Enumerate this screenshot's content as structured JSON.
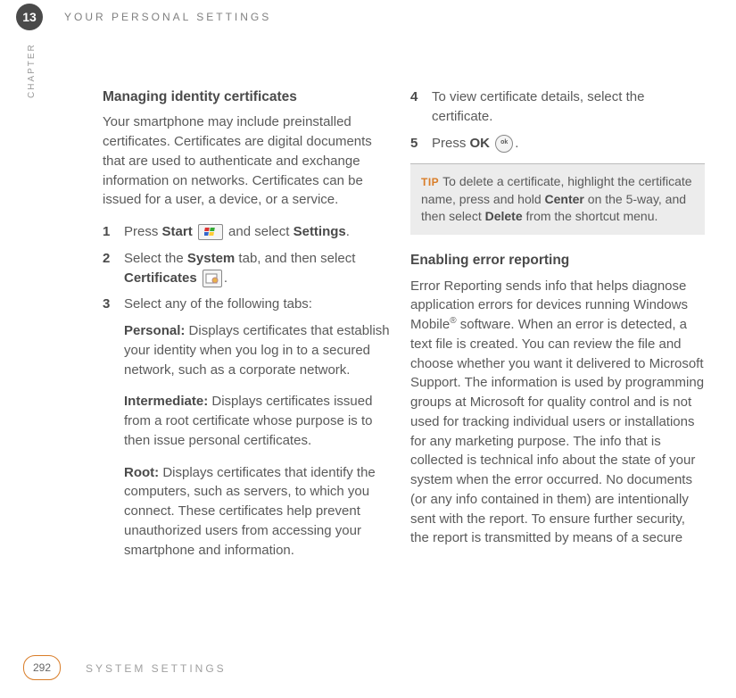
{
  "header": {
    "chapter_number": "13",
    "chapter_label": "CHAPTER",
    "running_title": "YOUR PERSONAL SETTINGS"
  },
  "col1": {
    "heading": "Managing identity certificates",
    "intro": "Your smartphone may include preinstalled certificates. Certificates are digital documents that are used to authenticate and exchange information on networks. Certificates can be issued for a user, a device, or a service.",
    "step1": {
      "num": "1",
      "a": "Press ",
      "b1": "Start",
      "c": " and select ",
      "b2": "Settings",
      "d": "."
    },
    "step2": {
      "num": "2",
      "a": "Select the ",
      "b1": "System",
      "c": " tab, and then select ",
      "b2": "Certificates",
      "d": "."
    },
    "step3": {
      "num": "3",
      "a": "Select any of the following tabs:"
    },
    "personal": {
      "label": "Personal:",
      "text": " Displays certificates that establish your identity when you log in to a secured network, such as a corporate network."
    },
    "intermediate": {
      "label": "Intermediate:",
      "text": " Displays certificates issued from a root certificate whose purpose is to then issue personal certificates."
    },
    "root": {
      "label": "Root:",
      "text": " Displays certificates that identify the computers, such as servers, to which you connect. These certificates help prevent unauthorized users from accessing your smartphone and information."
    }
  },
  "col2": {
    "step4": {
      "num": "4",
      "text": "To view certificate details, select the certificate."
    },
    "step5": {
      "num": "5",
      "a": "Press ",
      "b1": "OK",
      "c": "."
    },
    "tip": {
      "label": "TIP",
      "a": "To delete a certificate, highlight the certificate name, press and hold ",
      "b1": "Center",
      "c": " on the 5-way, and then select ",
      "b2": "Delete",
      "d": " from the shortcut menu."
    },
    "heading2": "Enabling error reporting",
    "para2a": "Error Reporting sends info that helps diagnose application errors for devices running Windows Mobile",
    "reg": "®",
    "para2b": " software. When an error is detected, a text file is created. You can review the file and choose whether you want it delivered to Microsoft Support. The information is used by programming groups at Microsoft for quality control and is not used for tracking individual users or installations for any marketing purpose. The info that is collected is technical info about the state of your system when the error occurred. No documents (or any info contained in them) are intentionally sent with the report. To ensure further security, the report is transmitted by means of a secure"
  },
  "footer": {
    "page_number": "292",
    "section_title": "SYSTEM SETTINGS"
  }
}
